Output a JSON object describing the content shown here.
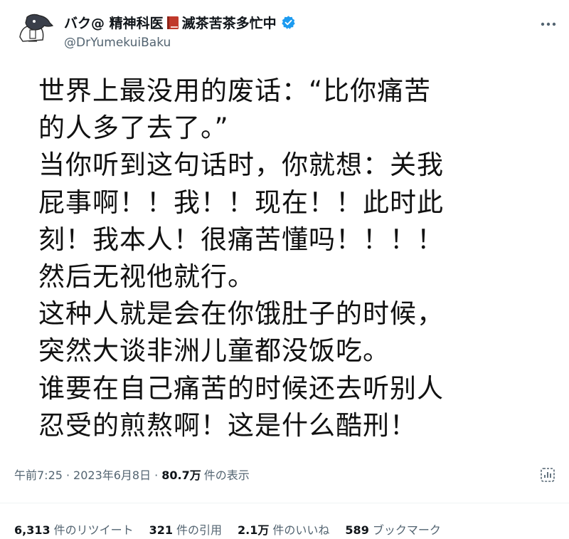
{
  "author": {
    "display_name_prefix": "バク@ 精神科医",
    "display_name_suffix": "滅茶苦茶多忙中",
    "handle": "@DrYumekuiBaku"
  },
  "tweet": {
    "lines": [
      "世界上最没用的废话：“比你痛苦",
      "的人多了去了。”",
      "当你听到这句话时，你就想：关我",
      "屁事啊！！我！！现在！！此时此",
      "刻！我本人！很痛苦懂吗！！！！",
      "然后无视他就行。",
      "这种人就是会在你饿肚子的时候，",
      "突然大谈非洲儿童都没饭吃。",
      "谁要在自己痛苦的时候还去听别人",
      "忍受的煎熬啊！这是什么酷刑！"
    ]
  },
  "meta": {
    "time": "午前7:25",
    "separator": "·",
    "date": "2023年6月8日",
    "views_count": "80.7万",
    "views_label": "件の表示"
  },
  "stats": [
    {
      "count": "6,313",
      "label": "件のリツイート"
    },
    {
      "count": "321",
      "label": "件の引用"
    },
    {
      "count": "2.1万",
      "label": "件のいいね"
    },
    {
      "count": "589",
      "label": "ブックマーク"
    }
  ],
  "colors": {
    "text": "#0f1419",
    "secondary": "#536471",
    "verified": "#1d9bf0",
    "book": "#c0392b",
    "divider": "#eff3f4"
  },
  "icons": {
    "avatar": "tapir-avatar",
    "book": "red-book-icon",
    "verified": "verified-badge-icon",
    "more": "more-icon",
    "analytics": "analytics-icon"
  }
}
